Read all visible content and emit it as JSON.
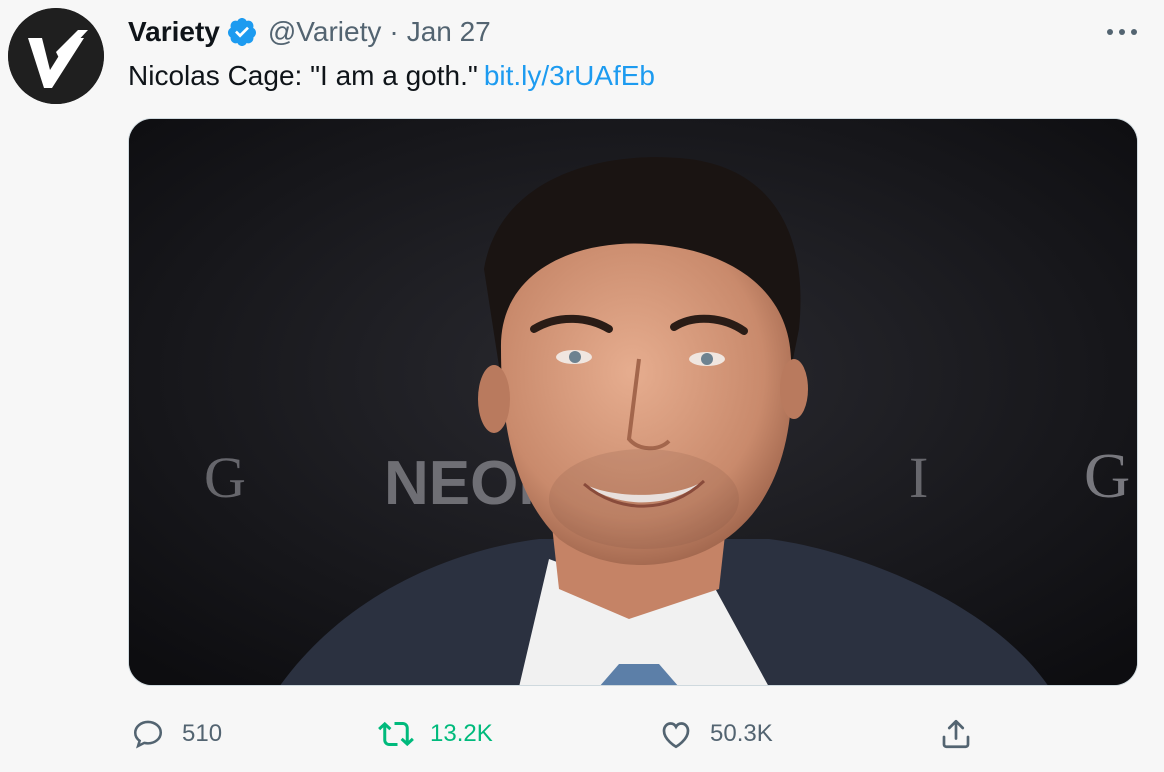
{
  "tweet": {
    "author_name": "Variety",
    "handle": "@Variety",
    "separator": "·",
    "date": "Jan 27",
    "text": "Nicolas Cage: \"I am a goth.\"",
    "link": "bit.ly/3rUAfEb",
    "avatar_letter": "V"
  },
  "media": {
    "backdrop_letters": [
      "G",
      "NEON",
      "I",
      "G"
    ]
  },
  "actions": {
    "replies": "510",
    "retweets": "13.2K",
    "likes": "50.3K"
  },
  "colors": {
    "link": "#1d9bf0",
    "verified": "#1d9bf0",
    "retweet_active": "#00ba7c",
    "secondary_text": "#536471"
  },
  "icons": [
    "verified-badge-icon",
    "more-dots-icon",
    "reply-icon",
    "retweet-icon",
    "like-icon",
    "share-icon"
  ]
}
